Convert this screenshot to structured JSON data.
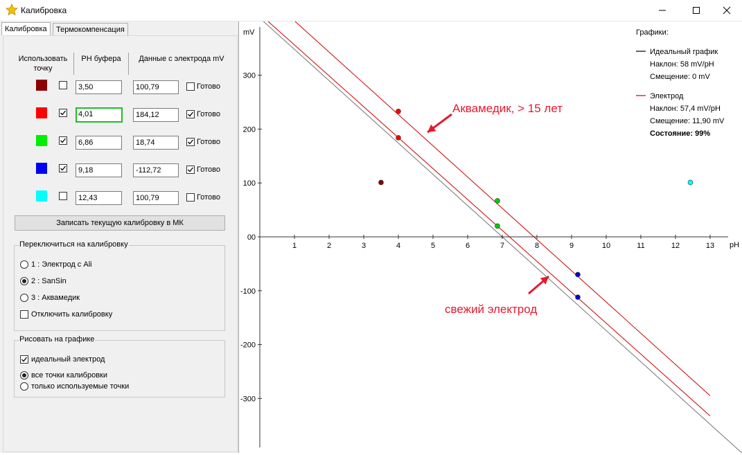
{
  "window": {
    "title": "Калибровка",
    "icon": "star-app-icon"
  },
  "tabs": [
    {
      "label": "Калибровка",
      "active": true
    },
    {
      "label": "Термокомпенсация",
      "active": false
    }
  ],
  "table": {
    "col_use": "Использовать точку",
    "col_ph": "PH буфера",
    "col_mv": "Данные с электрода mV",
    "ready_label": "Готово",
    "rows": [
      {
        "color": "#8b0000",
        "use": false,
        "ph": "3,50",
        "mv": "100,79",
        "ready": false
      },
      {
        "color": "#ff0000",
        "use": true,
        "ph": "4,01",
        "mv": "184,12",
        "ready": true
      },
      {
        "color": "#00ee00",
        "use": true,
        "ph": "6,86",
        "mv": "18,74",
        "ready": true
      },
      {
        "color": "#0000ee",
        "use": true,
        "ph": "9,18",
        "mv": "-112,72",
        "ready": true
      },
      {
        "color": "#00ffff",
        "use": false,
        "ph": "12,43",
        "mv": "100,79",
        "ready": false
      }
    ]
  },
  "write_button": "Записать текущую калибровку в МК",
  "switch_group": {
    "title": "Переключиться на калибровку",
    "options": [
      "1 : Электрод с Ali",
      "2 : SanSin",
      "3 : Аквамедик"
    ],
    "selected": 1,
    "disable_label": "Отключить калибровку",
    "disable_checked": false
  },
  "draw_group": {
    "title": "Рисовать на графике",
    "ideal_label": "идеальный электрод",
    "ideal_checked": true,
    "options": [
      "все  точки калибровки",
      "только используемые точки"
    ],
    "selected": 0
  },
  "chart_data": {
    "type": "scatter",
    "xlabel": "pH",
    "ylabel": "mV",
    "xlim": [
      0,
      14
    ],
    "ylim": [
      -390,
      390
    ],
    "xticks": [
      1,
      2,
      3,
      4,
      5,
      6,
      7,
      8,
      9,
      10,
      11,
      12,
      13
    ],
    "yticks": [
      300,
      200,
      100,
      0,
      -100,
      -200,
      -300
    ],
    "legend_title": "Графики:",
    "legend": [
      {
        "name": "Идеальный график",
        "color": "#000000",
        "lines": [
          "Наклон: 58 mV/pH",
          "Смещение: 0 mV"
        ]
      },
      {
        "name": "Электрод",
        "color": "#cc0000",
        "lines": [
          "Наклон: 57,4 mV/pH",
          "Смещение: 11,90 mV"
        ],
        "state": "Состояние: 99%"
      }
    ],
    "series_lines": [
      {
        "color": "#000000",
        "slope": -58,
        "intercept_ph": 7,
        "offset": 0,
        "x_range": [
          0,
          14
        ]
      },
      {
        "color": "#cc0000",
        "slope": -57.4,
        "intercept_ph": 7,
        "offset": 11.9,
        "x_range": [
          0,
          13
        ]
      },
      {
        "color": "#cc0000",
        "slope": -58,
        "intercept_ph": 7,
        "offset": 53,
        "x_range": [
          0,
          13
        ]
      }
    ],
    "points": [
      {
        "x": 3.5,
        "y": 101,
        "color": "#8b0000"
      },
      {
        "x": 4.0,
        "y": 233,
        "color": "#ff0000"
      },
      {
        "x": 4.0,
        "y": 184,
        "color": "#ff0000"
      },
      {
        "x": 6.86,
        "y": 67,
        "color": "#00cc00"
      },
      {
        "x": 6.86,
        "y": 20,
        "color": "#00cc00"
      },
      {
        "x": 9.18,
        "y": -70,
        "color": "#0000cc"
      },
      {
        "x": 9.18,
        "y": -112,
        "color": "#0000cc"
      },
      {
        "x": 12.43,
        "y": 101,
        "color": "#00ffff"
      }
    ],
    "annotations": [
      {
        "text": "Аквамедик, > 15 лет",
        "color": "#e8182b"
      },
      {
        "text": "свежий электрод",
        "color": "#e8182b"
      }
    ]
  }
}
